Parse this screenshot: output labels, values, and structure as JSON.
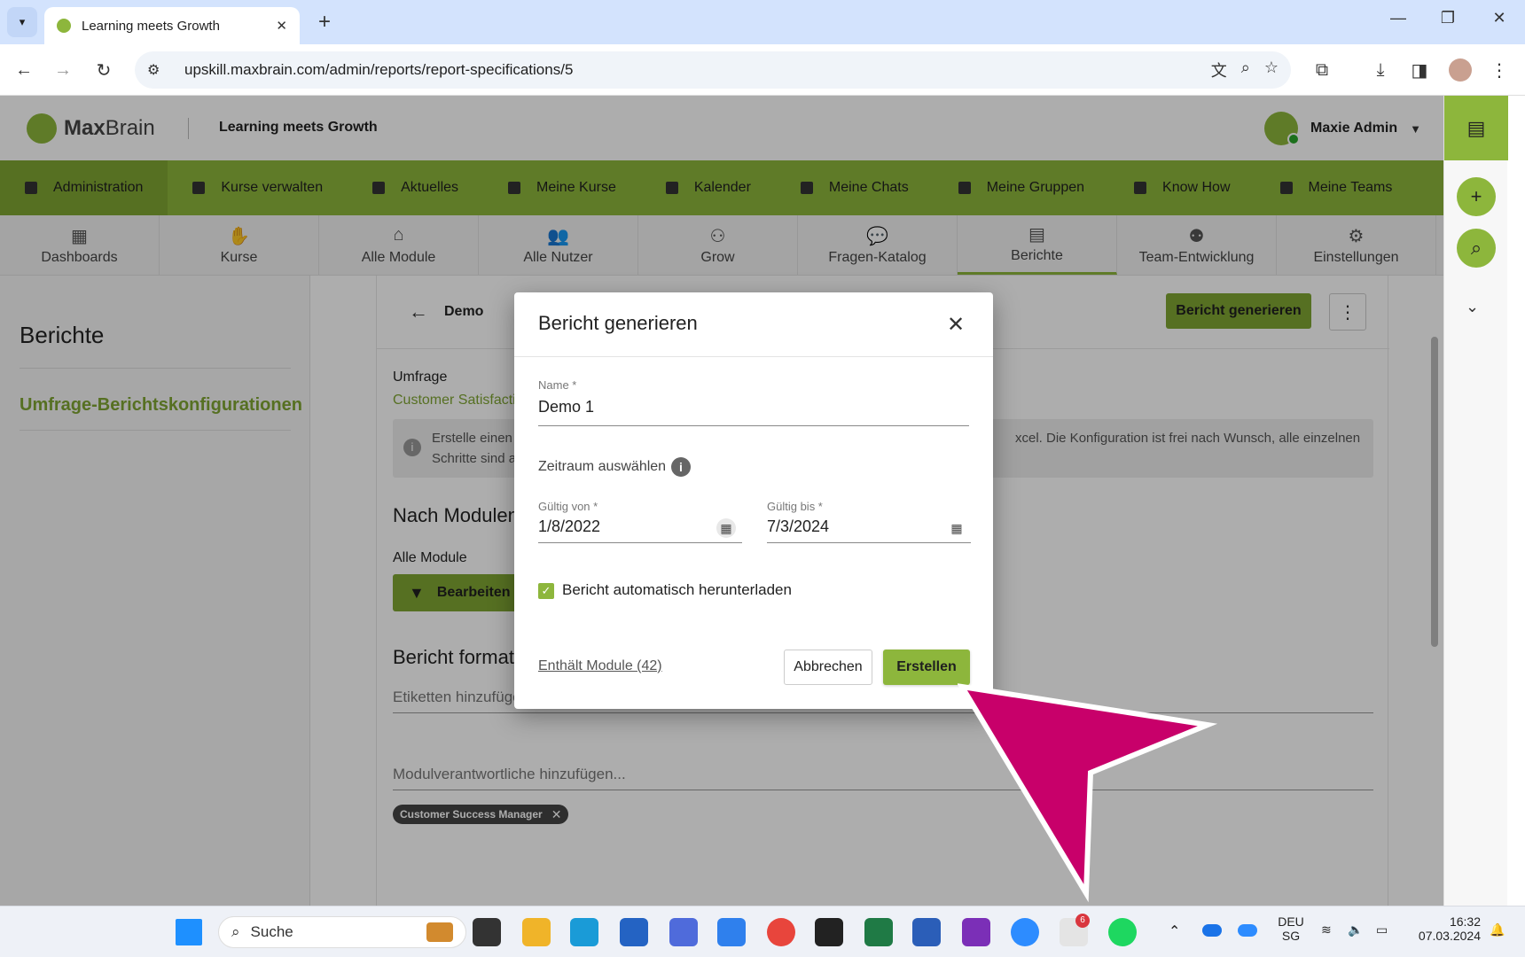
{
  "browser": {
    "tab_title": "Learning meets Growth",
    "url": "upskill.maxbrain.com/admin/reports/report-specifications/5"
  },
  "header": {
    "brand_bold": "Max",
    "brand_light": "Brain",
    "tagline": "Learning meets Growth",
    "user_name": "Maxie Admin"
  },
  "main_nav": [
    {
      "label": "Administration",
      "icon": "dashboard-icon"
    },
    {
      "label": "Kurse verwalten",
      "icon": "folder-icon"
    },
    {
      "label": "Aktuelles",
      "icon": "dashboard-icon"
    },
    {
      "label": "Meine Kurse",
      "icon": "graduation-cap-icon"
    },
    {
      "label": "Kalender",
      "icon": "calendar-icon"
    },
    {
      "label": "Meine Chats",
      "icon": "chat-icon"
    },
    {
      "label": "Meine Gruppen",
      "icon": "folder-icon"
    },
    {
      "label": "Know How",
      "icon": "book-icon"
    },
    {
      "label": "Meine Teams",
      "icon": "team-icon"
    }
  ],
  "sub_nav": [
    {
      "label": "Dashboards",
      "glyph": "▦"
    },
    {
      "label": "Kurse",
      "glyph": "✋"
    },
    {
      "label": "Alle Module",
      "glyph": "⌂"
    },
    {
      "label": "Alle Nutzer",
      "glyph": "👥"
    },
    {
      "label": "Grow",
      "glyph": "⚇"
    },
    {
      "label": "Fragen-Katalog",
      "glyph": "💬"
    },
    {
      "label": "Berichte",
      "glyph": "▤"
    },
    {
      "label": "Team-Entwicklung",
      "glyph": "⚉"
    },
    {
      "label": "Einstellungen",
      "glyph": "⚙"
    }
  ],
  "sidebar": {
    "heading": "Berichte",
    "link": "Umfrage-Berichtskonfigurationen"
  },
  "content": {
    "breadcrumb": "Demo",
    "generate_button": "Bericht generieren",
    "survey_label": "Umfrage",
    "survey_value": "Customer Satisfactio",
    "info_line1_a": "Erstelle einen",
    "info_line1_b": "xcel. Die Konfiguration ist frei nach Wunsch, alle einzelnen",
    "info_line2": "Schritte sind a",
    "section_modules": "Nach Modulen",
    "all_modules": "Alle Module",
    "edit_button": "Bearbeiten",
    "section_format": "Bericht format",
    "tags_placeholder": "Etiketten hinzufügen...",
    "owners_placeholder": "Modulverantwortliche hinzufügen...",
    "chip": "Customer Success Manager"
  },
  "dialog": {
    "title": "Bericht generieren",
    "name_label": "Name *",
    "name_value": "Demo 1",
    "period_label": "Zeitraum auswählen",
    "from_label": "Gültig von *",
    "from_value": "1/8/2022",
    "to_label": "Gültig bis *",
    "to_value": "7/3/2024",
    "auto_download_label": "Bericht automatisch herunterladen",
    "auto_download_checked": true,
    "modules_link": "Enthält Module (42)",
    "cancel": "Abbrechen",
    "create": "Erstellen"
  },
  "annotation": {
    "arrow_color": "#c8006a"
  },
  "taskbar": {
    "search_placeholder": "Suche",
    "slack_badge": "6",
    "lang_top": "DEU",
    "lang_bottom": "SG",
    "time": "16:32",
    "date": "07.03.2024"
  },
  "colors": {
    "brand_green": "#8db63c",
    "brand_green_dark": "#7fa533"
  }
}
